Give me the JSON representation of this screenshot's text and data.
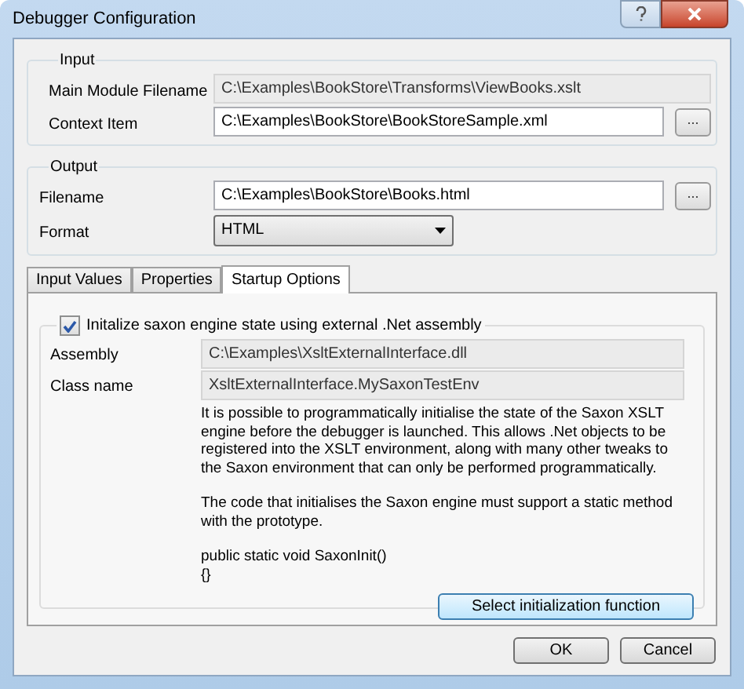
{
  "window": {
    "title": "Debugger Configuration"
  },
  "input": {
    "legend": "Input",
    "rows": [
      {
        "label": "Main Module Filename",
        "value": "C:\\Examples\\BookStore\\Transforms\\ViewBooks.xslt",
        "editable": false
      },
      {
        "label": "Context Item",
        "value": "C:\\Examples\\BookStore\\BookStoreSample.xml",
        "editable": true,
        "browse": "..."
      }
    ]
  },
  "output": {
    "legend": "Output",
    "rows": [
      {
        "label": "Filename",
        "value": "C:\\Examples\\BookStore\\Books.html",
        "editable": true,
        "browse": "..."
      }
    ],
    "format": {
      "label": "Format",
      "value": "HTML"
    }
  },
  "tabs": [
    {
      "label": "Input Values",
      "selected": false
    },
    {
      "label": "Properties",
      "selected": false
    },
    {
      "label": "Startup Options",
      "selected": true
    }
  ],
  "startup": {
    "checkbox": {
      "label": "Initalize saxon engine state using external .Net assembly",
      "checked": true
    },
    "rows": [
      {
        "label": "Assembly",
        "value": "C:\\Examples\\XsltExternalInterface.dll"
      },
      {
        "label": "Class name",
        "value": "XsltExternalInterface.MySaxonTestEnv"
      }
    ],
    "paragraphs": [
      "It is possible to programmatically initialise the state of the Saxon XSLT engine before the debugger is launched. This allows .Net objects to be registered into the XSLT environment, along with many other tweaks to the Saxon environment that can only be performed programmatically.",
      "The code that initialises the Saxon engine must support a static method with the prototype."
    ],
    "code": [
      "public static void SaxonInit()",
      "{}"
    ],
    "button": "Select initialization function"
  },
  "buttons": [
    "OK",
    "Cancel"
  ]
}
